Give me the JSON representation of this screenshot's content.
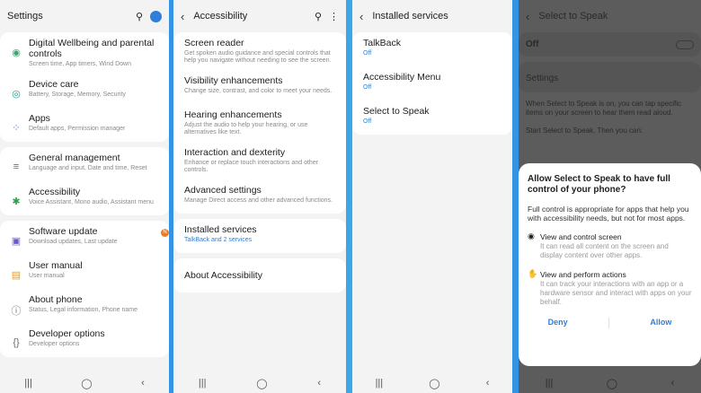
{
  "panel1": {
    "title": "Settings",
    "items": [
      {
        "icon": "heart-clock-icon",
        "title": "Digital Wellbeing and parental controls",
        "sub": "Screen time, App timers, Wind Down",
        "color": "#3fa36a"
      },
      {
        "icon": "device-care-icon",
        "title": "Device care",
        "sub": "Battery, Storage, Memory, Security",
        "color": "#1e9c8f"
      },
      {
        "icon": "apps-icon",
        "title": "Apps",
        "sub": "Default apps, Permission manager",
        "color": "#3b74d6"
      },
      {
        "icon": "sliders-icon",
        "title": "General management",
        "sub": "Language and input, Date and time, Reset",
        "color": "#3f6ad8"
      },
      {
        "icon": "accessibility-icon",
        "title": "Accessibility",
        "sub": "Voice Assistant, Mono audio, Assistant menu",
        "color": "#2fa34b"
      },
      {
        "icon": "software-update-icon",
        "title": "Software update",
        "sub": "Download updates, Last update",
        "color": "#6f55d6",
        "badge": "N"
      },
      {
        "icon": "manual-icon",
        "title": "User manual",
        "sub": "User manual",
        "color": "#e79a1e"
      },
      {
        "icon": "info-icon",
        "title": "About phone",
        "sub": "Status, Legal information, Phone name",
        "color": "#6a6a6a"
      },
      {
        "icon": "braces-icon",
        "title": "Developer options",
        "sub": "Developer options",
        "color": "#6a6a6a"
      }
    ]
  },
  "panel2": {
    "title": "Accessibility",
    "items": [
      {
        "title": "Screen reader",
        "sub": "Get spoken audio guidance and special controls that help you navigate without needing to see the screen."
      },
      {
        "title": "Visibility enhancements",
        "sub": "Change size, contrast, and color to meet your needs."
      },
      {
        "title": "Hearing enhancements",
        "sub": "Adjust the audio to help your hearing, or use alternatives like text."
      },
      {
        "title": "Interaction and dexterity",
        "sub": "Enhance or replace touch interactions and other controls."
      },
      {
        "title": "Advanced settings",
        "sub": "Manage Direct access and other advanced functions."
      }
    ],
    "installed": {
      "title": "Installed services",
      "sub": "TalkBack and 2 services"
    },
    "about": "About Accessibility"
  },
  "panel3": {
    "title": "Installed services",
    "items": [
      {
        "title": "TalkBack",
        "sub": "Off"
      },
      {
        "title": "Accessibility Menu",
        "sub": "Off"
      },
      {
        "title": "Select to Speak",
        "sub": "Off"
      }
    ]
  },
  "panel4": {
    "title": "Select to Speak",
    "off": "Off",
    "settings": "Settings",
    "desc": "When Select to Speak is on, you can tap specific items on your screen to hear them read aloud.",
    "start": "Start Select to Speak. Then you can:",
    "dialog": {
      "title": "Allow Select to Speak to have full control of your phone?",
      "body": "Full control is appropriate for apps that help you with accessibility needs, but not for most apps.",
      "perm1_title": "View and control screen",
      "perm1_desc": "It can read all content on the screen and display content over other apps.",
      "perm2_title": "View and perform actions",
      "perm2_desc": "It can track your interactions with an app or a hardware sensor and interact with apps on your behalf.",
      "deny": "Deny",
      "allow": "Allow"
    }
  },
  "nav": {
    "recent": "|||",
    "home": "◯",
    "back": "‹"
  }
}
